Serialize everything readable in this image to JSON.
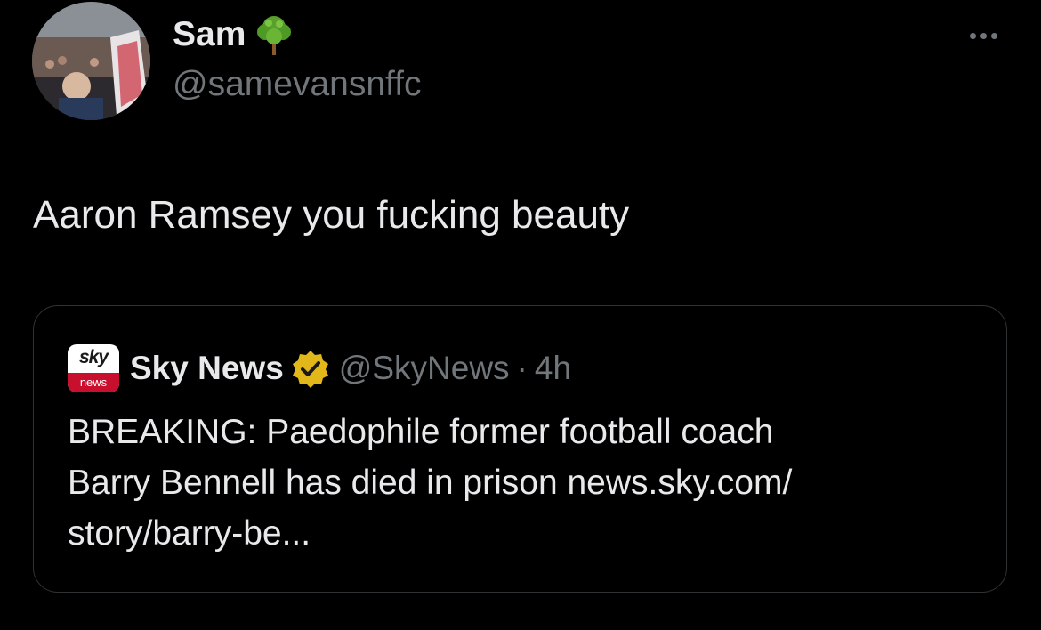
{
  "tweet": {
    "author": {
      "display_name": "Sam",
      "handle": "@samevansnffc",
      "name_emoji": "tree-icon",
      "avatar": "avatar-photo"
    },
    "more_icon": "more-horizontal-icon",
    "text": "Aaron Ramsey you fucking beauty"
  },
  "quote": {
    "logo": {
      "top": "sky",
      "bottom": "news",
      "accent_color": "#c8102e"
    },
    "author_name": "Sky News",
    "verified_icon": "verified-gold-badge-icon",
    "verified_color": "#e2b719",
    "handle": "@SkyNews",
    "separator": "·",
    "time": "4h",
    "text_lines": [
      "BREAKING: Paedophile former football coach",
      "Barry Bennell has died in prison news.sky.com/",
      "story/barry-be..."
    ]
  },
  "colors": {
    "background": "#000000",
    "primary_text": "#e7e9ea",
    "secondary_text": "#71767b",
    "border": "#2f3336"
  }
}
